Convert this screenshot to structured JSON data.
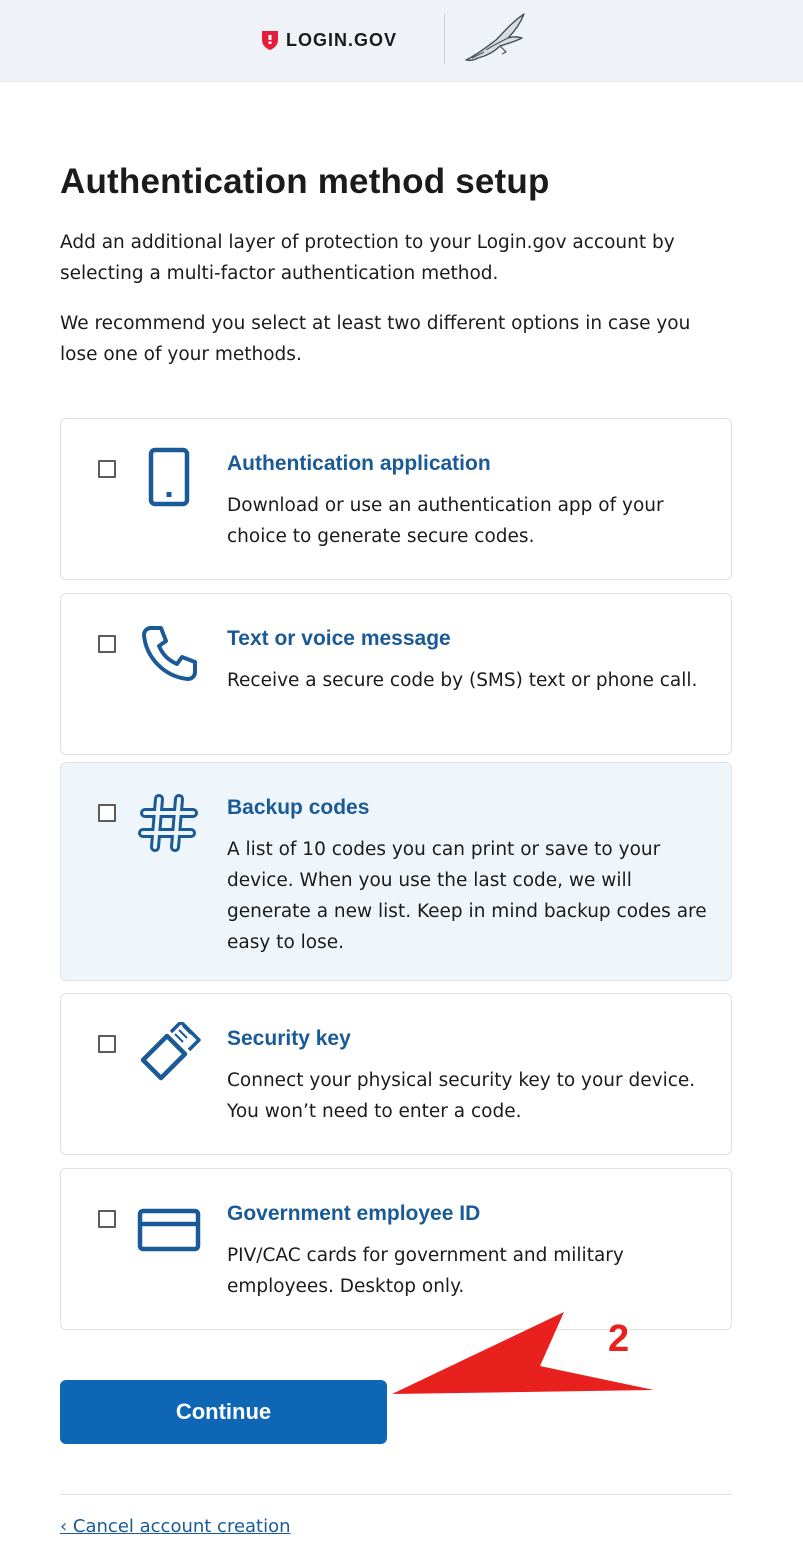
{
  "header": {
    "brand_text": "LOGIN.GOV",
    "icons": [
      "shield-logo-icon",
      "eagle-icon"
    ],
    "brand_color": "#e41d3d"
  },
  "main": {
    "title": "Authentication method setup",
    "intro_1": "Add an additional layer of protection to your Login.gov account by selecting a multi-factor authentication method.",
    "intro_2": "We recommend you select at least two different options in case you lose one of your methods."
  },
  "options": [
    {
      "title": "Authentication application",
      "description": "Download or use an authentication app of your choice to generate secure codes.",
      "icon": "mobile-device-icon",
      "checked": false,
      "highlighted": false
    },
    {
      "title": "Text or voice message",
      "description": "Receive a secure code by (SMS) text or phone call.",
      "icon": "phone-icon",
      "checked": false,
      "highlighted": false
    },
    {
      "title": "Backup codes",
      "description": "A list of 10 codes you can print or save to your device. When you use the last code, we will generate a new list. Keep in mind backup codes are easy to lose.",
      "icon": "hashtag-icon",
      "checked": false,
      "highlighted": true
    },
    {
      "title": "Security key",
      "description": "Connect your physical security key to your device. You won’t need to enter a code.",
      "icon": "security-key-icon",
      "checked": false,
      "highlighted": false
    },
    {
      "title": "Government employee ID",
      "description": "PIV/CAC cards for government and military employees. Desktop only.",
      "icon": "id-card-icon",
      "checked": false,
      "highlighted": false
    }
  ],
  "actions": {
    "continue_label": "Continue",
    "cancel_label": "‹ Cancel account creation"
  },
  "annotation": {
    "number": "2",
    "color": "#e8211f"
  },
  "colors": {
    "link": "#1a5a96",
    "button": "#0e66b4",
    "header_bg": "#eff3f8",
    "highlight_bg": "#eff6fb"
  }
}
